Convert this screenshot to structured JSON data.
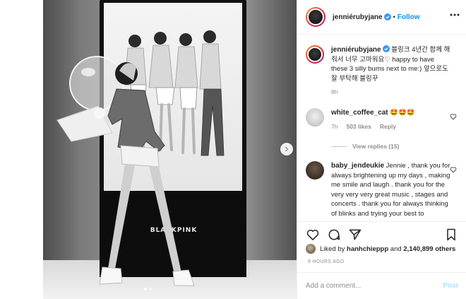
{
  "post": {
    "username": "jenniérubyjane",
    "follow_label": "Follow",
    "separator": "•",
    "icons": {
      "verified": "verified-badge-icon",
      "more": "more-options-icon",
      "next": "chevron-right-icon",
      "like": "heart-icon",
      "comment": "comment-icon",
      "share": "paper-plane-icon",
      "save": "bookmark-icon"
    },
    "image": {
      "kiosk_logo": "BLACKPINK",
      "carousel": {
        "count": 2,
        "active": 1
      }
    },
    "caption": {
      "username": "jenniérubyjane",
      "text": "블링크 4년간 함께 해줘서 너무 고마워요♡ happy to have these 3 silly bums next to me:) 앞으로도 잘 부탁해 블링꾸",
      "time": "8h"
    },
    "comments": [
      {
        "username": "white_coffee_cat",
        "text": "🤩🤩🤩",
        "time": "7h",
        "likes": "503 likes",
        "reply_label": "Reply",
        "view_replies": "View replies (15)"
      },
      {
        "username": "baby_jendeukie",
        "text": "Jennie , thank you for always brightening up my days , making me smile and laugh . thank you for the very very very great music , stages and concerts . thank you for always thinking of blinks and trying your best to"
      }
    ],
    "likes": {
      "prefix": "Liked by",
      "user": "hanhchieppp",
      "and": "and",
      "count": "2,140,899 others"
    },
    "timestamp": "8 HOURS AGO",
    "add_comment": {
      "placeholder": "Add a comment...",
      "post_label": "Post"
    },
    "colors": {
      "accent": "#0095f6",
      "verified": "#3897f0",
      "muted": "#8e8e8e"
    }
  }
}
